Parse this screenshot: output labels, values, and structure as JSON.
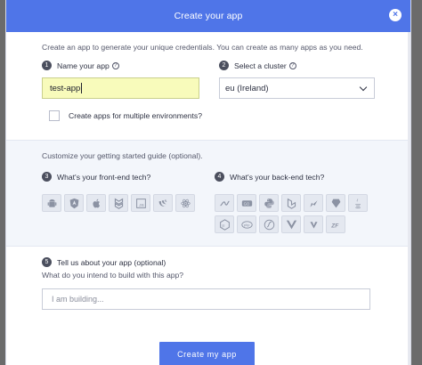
{
  "modal": {
    "title": "Create your app",
    "close_glyph": "×",
    "intro": "Create an app to generate your unique credentials. You can create as many apps as you need."
  },
  "name_field": {
    "step": "1",
    "label": "Name your app",
    "value": "test-app"
  },
  "cluster_field": {
    "step": "2",
    "label": "Select a cluster",
    "selected": "eu (Ireland)"
  },
  "multi_env": {
    "label": "Create apps for multiple environments?",
    "checked": false
  },
  "guide": {
    "title": "Customize your getting started guide (optional).",
    "frontend": {
      "step": "3",
      "label": "What's your front-end tech?",
      "icons": [
        {
          "name": "android-icon",
          "glyph": ""
        },
        {
          "name": "angular-icon",
          "glyph": "A"
        },
        {
          "name": "apple-icon",
          "glyph": ""
        },
        {
          "name": "backbone-icon",
          "glyph": ""
        },
        {
          "name": "javascript-icon",
          "glyph": "JS"
        },
        {
          "name": "jquery-icon",
          "glyph": ""
        },
        {
          "name": "react-icon",
          "glyph": ""
        }
      ]
    },
    "backend": {
      "step": "4",
      "label": "What's your back-end tech?",
      "icons": [
        {
          "name": "dotnet-icon",
          "glyph": ""
        },
        {
          "name": "go-icon",
          "glyph": "GO"
        },
        {
          "name": "python-icon",
          "glyph": ""
        },
        {
          "name": "laravel-icon",
          "glyph": ""
        },
        {
          "name": "django-icon",
          "glyph": ""
        },
        {
          "name": "ruby-icon",
          "glyph": ""
        },
        {
          "name": "java-icon",
          "glyph": ""
        },
        {
          "name": "nodejs-icon",
          "glyph": ""
        },
        {
          "name": "php-icon",
          "glyph": "php"
        },
        {
          "name": "rails-icon",
          "glyph": ""
        },
        {
          "name": "symfony-icon",
          "glyph": "sf"
        },
        {
          "name": "vue-icon",
          "glyph": "V"
        },
        {
          "name": "zend-icon",
          "glyph": "ZF"
        }
      ]
    }
  },
  "about": {
    "step": "5",
    "label": "Tell us about your app (optional)",
    "sub": "What do you intend to build with this app?",
    "placeholder": "I am building..."
  },
  "footer": {
    "create_label": "Create my app"
  },
  "colors": {
    "accent": "#4f75e8",
    "input_highlight": "#f8fbbb",
    "guide_bg": "#f3f6fb"
  }
}
